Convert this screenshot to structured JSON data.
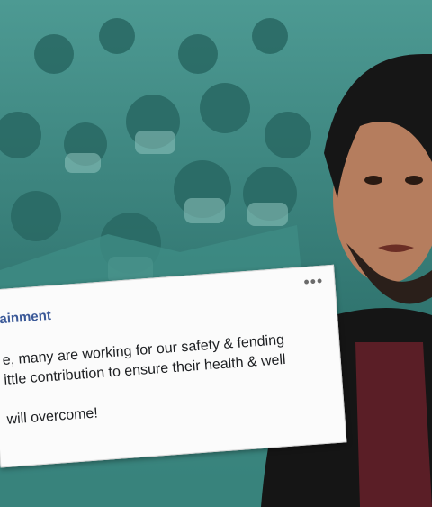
{
  "post": {
    "page_name": "ainment",
    "more_icon": "•••",
    "lines": [
      "e, many are working for our safety & fending",
      "ittle contribution to ensure their health & well",
      "will overcome!"
    ]
  },
  "colors": {
    "teal_bg": "#2f7c76",
    "link_blue": "#3b5998",
    "card_bg": "#fbfbfb"
  }
}
